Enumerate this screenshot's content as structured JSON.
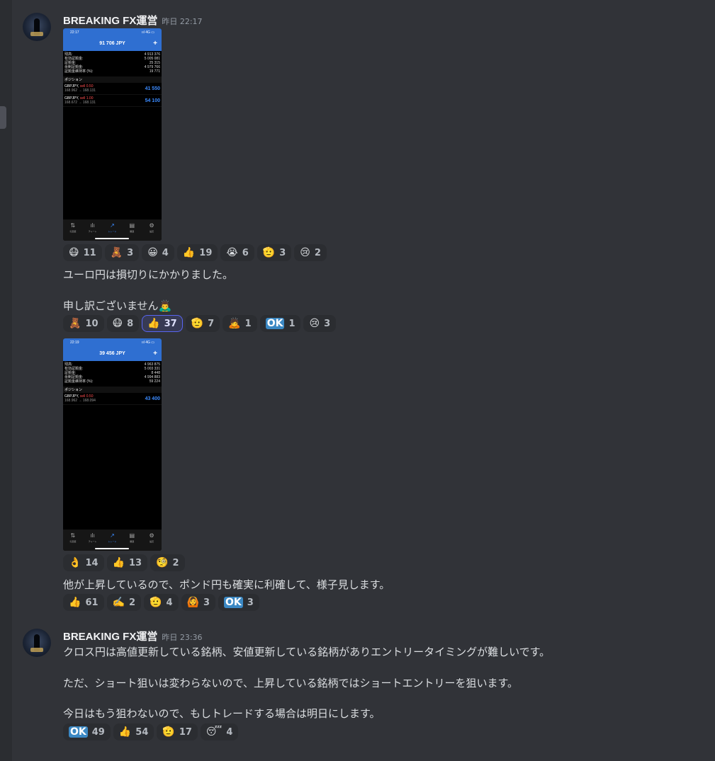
{
  "message_group_1": {
    "author": "BREAKING FX運営",
    "timestamp": "昨日 22:17",
    "screenshot_1": {
      "status_time": "22:17",
      "status_icons": "ııl 4G ▭",
      "title": "91 706 JPY",
      "plus": "+",
      "rows": [
        {
          "label": "残高:",
          "value": "4 913 376"
        },
        {
          "label": "有効証拠金:",
          "value": "5 005 081"
        },
        {
          "label": "証拠金:",
          "value": "25 315"
        },
        {
          "label": "余剰証拠金:",
          "value": "4 979 766"
        },
        {
          "label": "証拠金維持率 (%):",
          "value": "19 771"
        }
      ],
      "section": "ポジション",
      "positions": [
        {
          "symbol": "GBPJPY,",
          "side": "sell 0.50",
          "range": "168.962 → 168.131",
          "pnl": "41 550"
        },
        {
          "symbol": "GBPJPY,",
          "side": "sell 1.00",
          "range": "168.672 → 168.131",
          "pnl": "54 100"
        }
      ]
    },
    "reactions_1": [
      {
        "emoji": "😷",
        "count": "11"
      },
      {
        "emoji": "🧸",
        "count": "3"
      },
      {
        "emoji": "😀",
        "count": "4"
      },
      {
        "emoji": "👍",
        "count": "19"
      },
      {
        "emoji": "😭",
        "count": "6"
      },
      {
        "emoji": "🫡",
        "count": "3"
      },
      {
        "emoji": "😢",
        "count": "2"
      }
    ],
    "text_1": "ユーロ円は損切りにかかりました。",
    "text_2": "申し訳ございません🙇‍♂️",
    "reactions_2": [
      {
        "emoji": "🧸",
        "count": "10"
      },
      {
        "emoji": "😷",
        "count": "8"
      },
      {
        "emoji": "👍",
        "count": "37"
      },
      {
        "emoji": "🫡",
        "count": "7"
      },
      {
        "emoji": "🙇",
        "count": "1"
      },
      {
        "emoji": "OK",
        "count": "1"
      },
      {
        "emoji": "😢",
        "count": "3"
      }
    ],
    "screenshot_2": {
      "status_time": "22:19",
      "status_icons": "ııl 4G ▭",
      "title": "39 456 JPY",
      "plus": "+",
      "rows": [
        {
          "label": "残高:",
          "value": "4 963 875"
        },
        {
          "label": "有効証拠金:",
          "value": "5 003 331"
        },
        {
          "label": "証拠金:",
          "value": "8 448"
        },
        {
          "label": "余剰証拠金:",
          "value": "4 994 883"
        },
        {
          "label": "証拠金維持率 (%):",
          "value": "59 224"
        }
      ],
      "section": "ポジション",
      "positions": [
        {
          "symbol": "GBPJPY,",
          "side": "sell 0.50",
          "range": "168.962 → 168.094",
          "pnl": "43 400"
        }
      ]
    },
    "reactions_3": [
      {
        "emoji": "👌",
        "count": "14"
      },
      {
        "emoji": "👍",
        "count": "13"
      },
      {
        "emoji": "🧐",
        "count": "2"
      }
    ],
    "text_3": "他が上昇しているので、ポンド円も確実に利確して、様子見します。",
    "reactions_4": [
      {
        "emoji": "👍",
        "count": "61"
      },
      {
        "emoji": "✍️",
        "count": "2"
      },
      {
        "emoji": "🫡",
        "count": "4"
      },
      {
        "emoji": "🙆",
        "count": "3"
      },
      {
        "emoji": "OK",
        "count": "3"
      }
    ]
  },
  "message_group_2": {
    "author": "BREAKING FX運営",
    "timestamp": "昨日 23:36",
    "text_1": "クロス円は高値更新している銘柄、安値更新している銘柄がありエントリータイミングが難しいです。",
    "text_2": "ただ、ショート狙いは変わらないので、上昇している銘柄ではショートエントリーを狙います。",
    "text_3": "今日はもう狙わないので、もしトレードする場合は明日にします。",
    "reactions": [
      {
        "emoji": "OK",
        "count": "49"
      },
      {
        "emoji": "👍",
        "count": "54"
      },
      {
        "emoji": "🫡",
        "count": "17"
      },
      {
        "emoji": "😴",
        "count": "4"
      }
    ]
  },
  "phone_nav": [
    {
      "icon": "⇅",
      "label": "気配値"
    },
    {
      "icon": "ılı",
      "label": "チャート"
    },
    {
      "icon": "↗",
      "label": "トレード"
    },
    {
      "icon": "▤",
      "label": "履歴"
    },
    {
      "icon": "⚙",
      "label": "設定"
    }
  ]
}
